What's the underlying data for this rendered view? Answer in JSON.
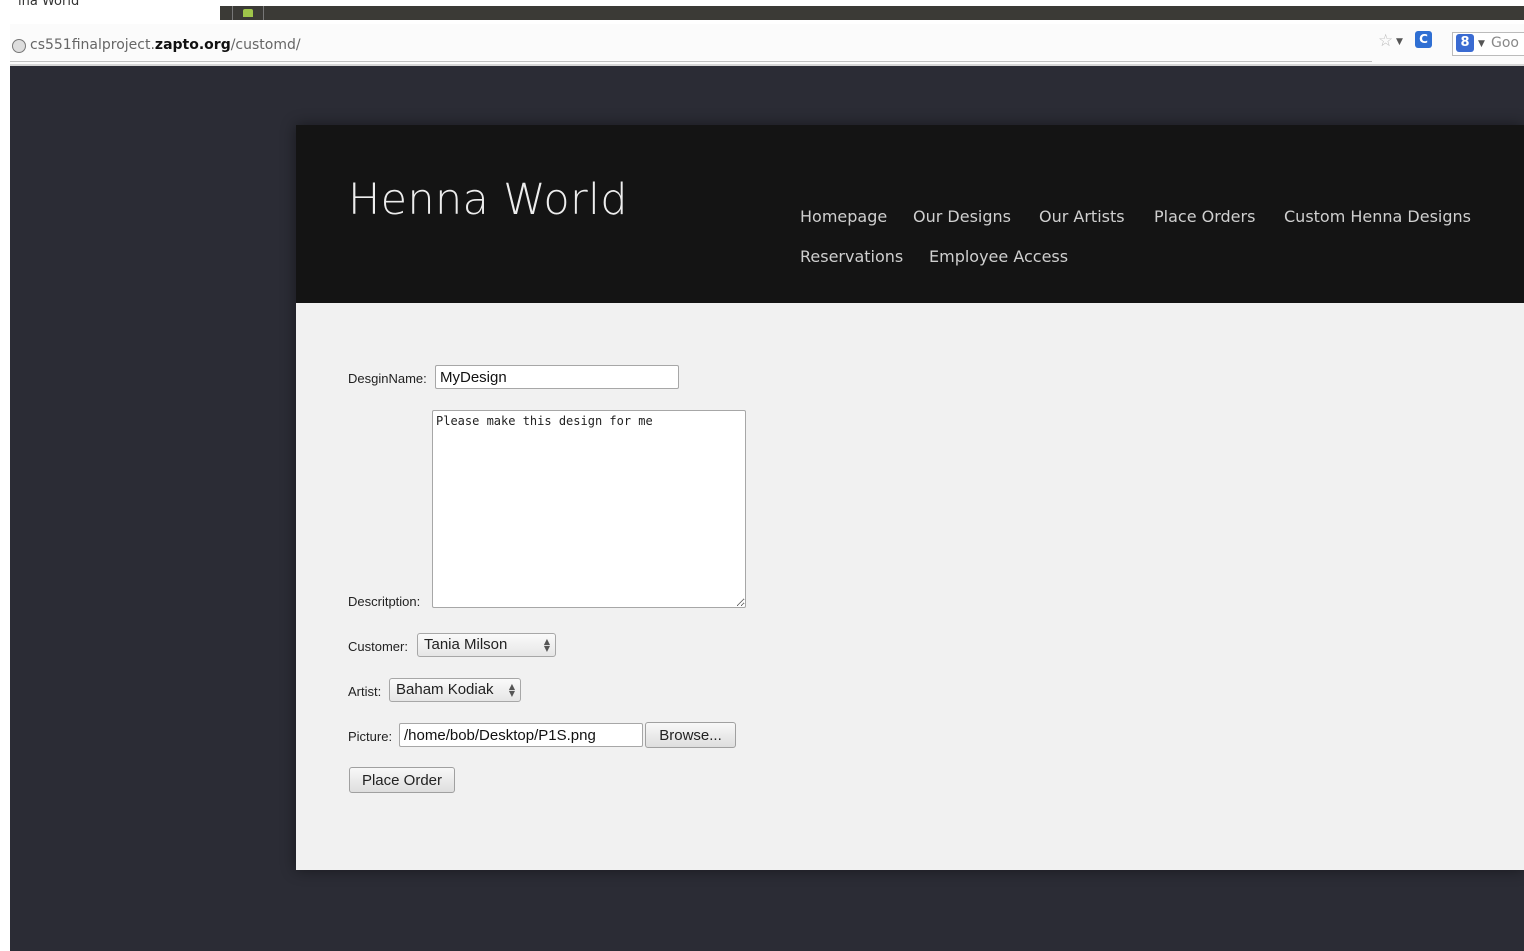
{
  "browser": {
    "tab_title": "ına World",
    "url_prefix": "cs551finalproject.",
    "url_domain": "zapto.org",
    "url_path": "/customd/",
    "search_engine_hint": "Goo"
  },
  "site": {
    "title": "Henna World",
    "nav": [
      {
        "label": "Homepage"
      },
      {
        "label": "Our Designs"
      },
      {
        "label": "Our Artists"
      },
      {
        "label": "Place Orders"
      },
      {
        "label": "Custom Henna Designs"
      },
      {
        "label": "Reservations"
      },
      {
        "label": "Employee Access"
      }
    ]
  },
  "form": {
    "design_name_label": "DesginName:",
    "design_name_value": "MyDesign",
    "description_label": "Descritption:",
    "description_value": "Please make this design for me",
    "customer_label": "Customer:",
    "customer_value": "Tania Milson",
    "artist_label": "Artist:",
    "artist_value": "Baham Kodiak",
    "picture_label": "Picture:",
    "picture_value": "/home/bob/Desktop/P1S.png",
    "browse_label": "Browse...",
    "submit_label": "Place Order"
  },
  "colors": {
    "page_background": "#2b2c35",
    "header_background": "#141414",
    "content_background": "#f1f1f1"
  }
}
